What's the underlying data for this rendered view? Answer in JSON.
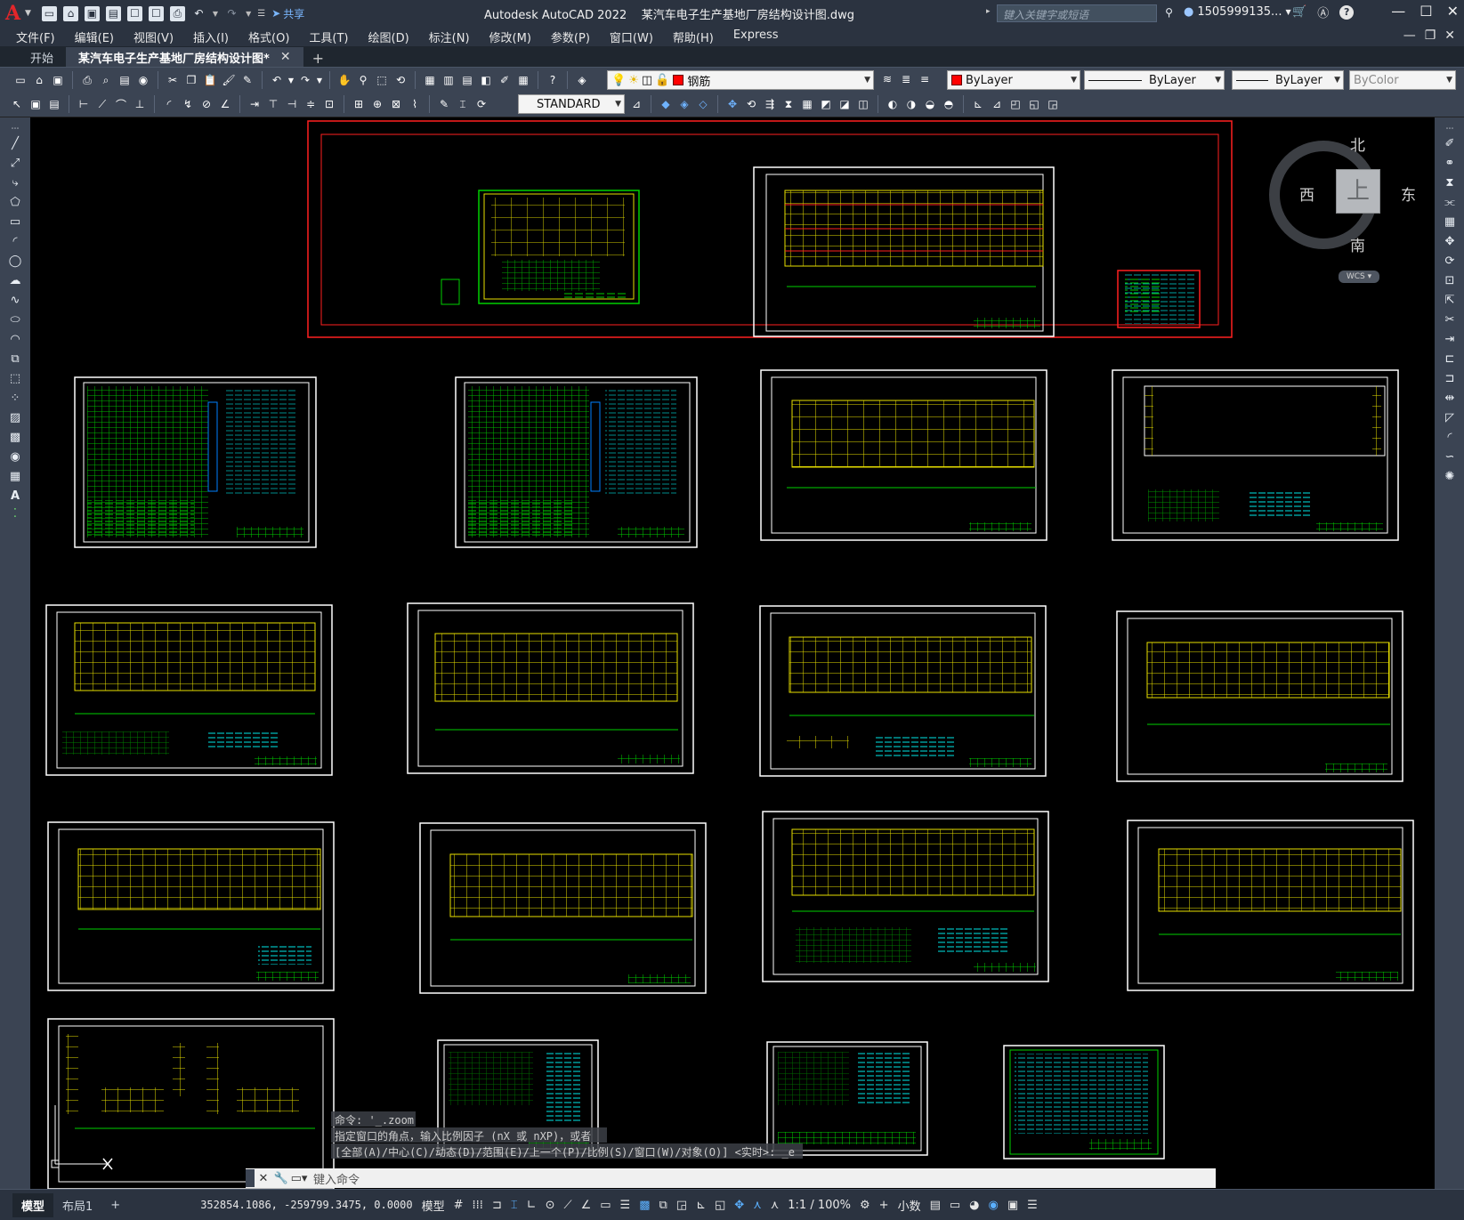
{
  "app": {
    "title": "Autodesk AutoCAD 2022",
    "document": "某汽车电子生产基地厂房结构设计图.dwg",
    "share_label": "共享",
    "search_placeholder": "键入关键字或短语",
    "user": "1505999135..."
  },
  "menu": [
    "文件(F)",
    "编辑(E)",
    "视图(V)",
    "插入(I)",
    "格式(O)",
    "工具(T)",
    "绘图(D)",
    "标注(N)",
    "修改(M)",
    "参数(P)",
    "窗口(W)",
    "帮助(H)",
    "Express"
  ],
  "tabs": [
    {
      "label": "开始",
      "active": false
    },
    {
      "label": "某汽车电子生产基地厂房结构设计图*",
      "active": true
    }
  ],
  "properties": {
    "layer": "钢筋",
    "layer_color": "#ff0000",
    "color": "ByLayer",
    "linetype": "ByLayer",
    "lineweight": "ByLayer",
    "plot_style": "ByColor",
    "text_style": "STANDARD"
  },
  "viewcube": {
    "north": "北",
    "south": "南",
    "east": "东",
    "west": "西",
    "face": "上",
    "wcs": "WCS"
  },
  "command": {
    "history": [
      "命令: '_.zoom",
      "指定窗口的角点，输入比例因子 (nX 或 nXP)，或者",
      "[全部(A)/中心(C)/动态(D)/范围(E)/上一个(P)/比例(S)/窗口(W)/对象(O)] <实时>: _e"
    ],
    "placeholder": "键入命令"
  },
  "layout_tabs": [
    {
      "label": "模型",
      "active": true
    },
    {
      "label": "布局1",
      "active": false
    }
  ],
  "status": {
    "coordinates": "352854.1086, -259799.3475, 0.0000",
    "space": "模型",
    "annotation_scale": "1:1 / 100%",
    "units": "小数"
  }
}
